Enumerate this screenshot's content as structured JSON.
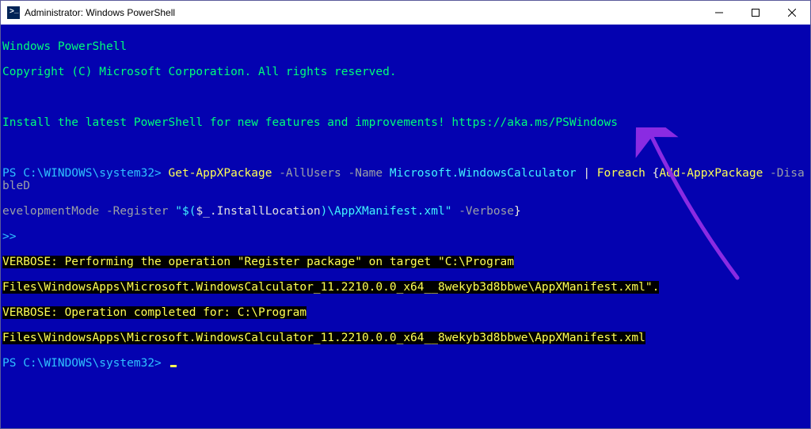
{
  "window": {
    "title": "Administrator: Windows PowerShell"
  },
  "term": {
    "banner1": "Windows PowerShell",
    "banner2": "Copyright (C) Microsoft Corporation. All rights reserved.",
    "install": "Install the latest PowerShell for new features and improvements! https://aka.ms/PSWindows",
    "prompt1": "PS C:\\WINDOWS\\system32> ",
    "cmd": {
      "get": "Get-AppXPackage",
      "p1": " -AllUsers -Name ",
      "target": "Microsoft.WindowsCalculator",
      "pipe_sp1": " ",
      "pipe": "|",
      "pipe_sp2": " ",
      "foreach": "Foreach",
      "brace_open": " {",
      "add": "Add-AppxPackage",
      "p2a": " -DisableD",
      "p2b": "evelopmentMode -Register ",
      "q1": "\"$(",
      "inst": "$_.InstallLocation",
      "q2": ")\\AppXManifest.xml\"",
      "p3": " -Verbose",
      "brace_close": "}"
    },
    "cont": ">>",
    "v1a": "VERBOSE: Performing the operation \"Register package\" on target \"C:\\Program",
    "v1b": "Files\\WindowsApps\\Microsoft.WindowsCalculator_11.2210.0.0_x64__8wekyb3d8bbwe\\AppXManifest.xml\".",
    "v2a": "VERBOSE: Operation completed for: C:\\Program",
    "v2b": "Files\\WindowsApps\\Microsoft.WindowsCalculator_11.2210.0.0_x64__8wekyb3d8bbwe\\AppXManifest.xml",
    "prompt2": "PS C:\\WINDOWS\\system32> "
  },
  "annotation": {
    "arrow_color": "#8a2be2"
  }
}
